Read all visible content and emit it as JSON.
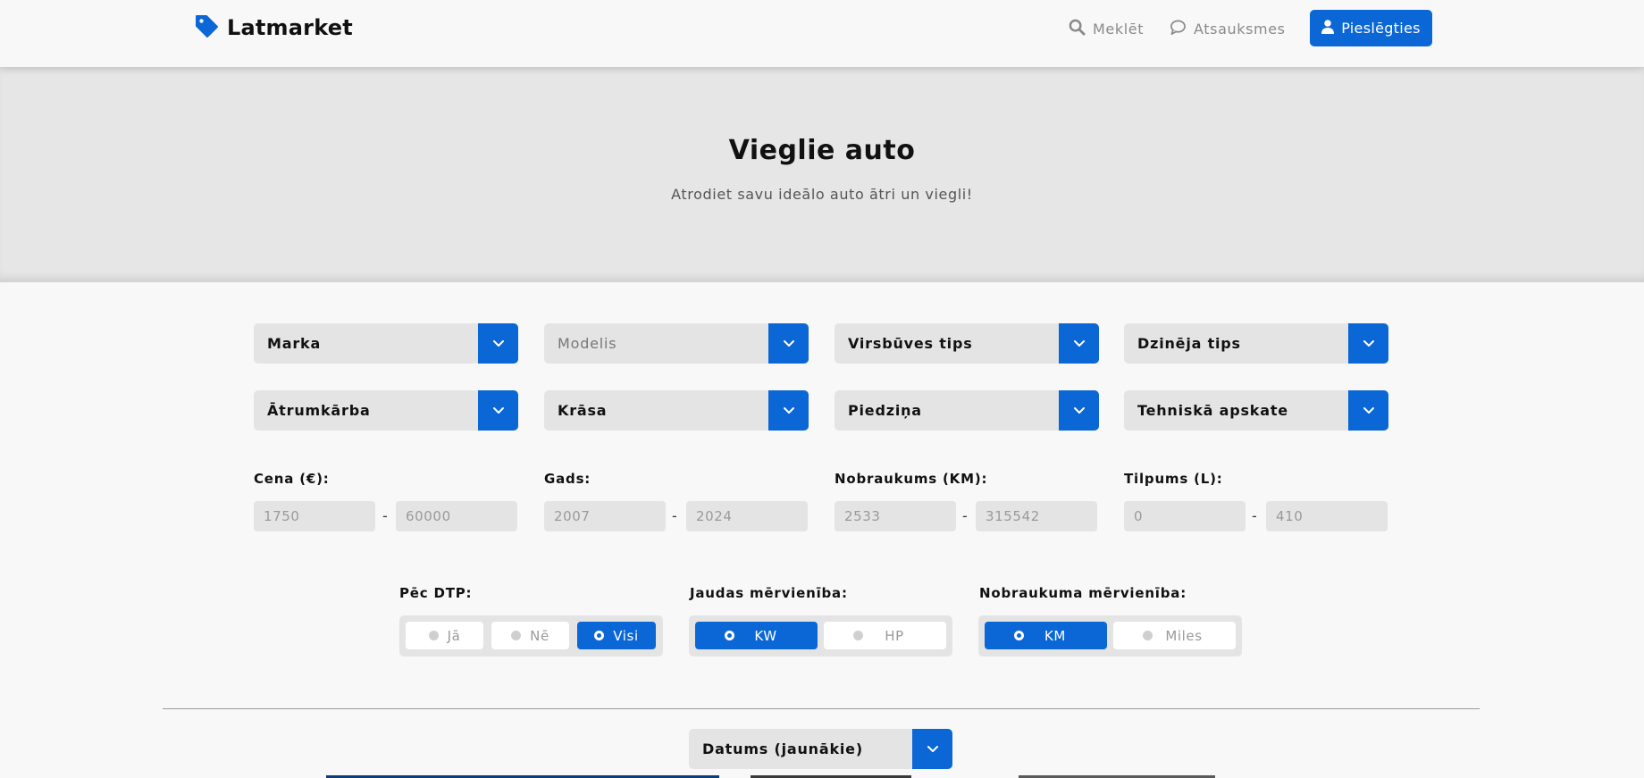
{
  "header": {
    "logo_text": "Latmarket",
    "nav": {
      "search": "Meklēt",
      "reviews": "Atsauksmes",
      "login": "Pieslēgties"
    }
  },
  "hero": {
    "title": "Vieglie auto",
    "subtitle": "Atrodiet savu ideālo auto ātri un viegli!"
  },
  "filters": {
    "selects": [
      {
        "label": "Marka"
      },
      {
        "label": "Modelis"
      },
      {
        "label": "Virsbūves tips"
      },
      {
        "label": "Dzinēja tips"
      },
      {
        "label": "Ātrumkārba"
      },
      {
        "label": "Krāsa"
      },
      {
        "label": "Piedziņa"
      },
      {
        "label": "Tehniskā apskate"
      }
    ],
    "ranges": [
      {
        "label": "Cena (€):",
        "min_placeholder": "1750",
        "max_placeholder": "60000"
      },
      {
        "label": "Gads:",
        "min_placeholder": "2007",
        "max_placeholder": "2024"
      },
      {
        "label": "Nobraukums (KM):",
        "min_placeholder": "2533",
        "max_placeholder": "315542"
      },
      {
        "label": "Tilpums (L):",
        "min_placeholder": "0",
        "max_placeholder": "410"
      }
    ],
    "range_separator": "-",
    "dtp": {
      "label": "Pēc DTP:",
      "options": [
        "Jā",
        "Nē",
        "Visi"
      ],
      "selected": "Visi"
    },
    "power_unit": {
      "label": "Jaudas mērvienība:",
      "options": [
        "KW",
        "HP"
      ],
      "selected": "KW"
    },
    "mileage_unit": {
      "label": "Nobraukuma mērvienība:",
      "options": [
        "KM",
        "Miles"
      ],
      "selected": "KM"
    }
  },
  "sort": {
    "label": "Datums (jaunākie)"
  },
  "colors": {
    "accent": "#0b67d6",
    "hero_bg": "#e6e6e6",
    "page_bg": "#f8f8f8"
  }
}
